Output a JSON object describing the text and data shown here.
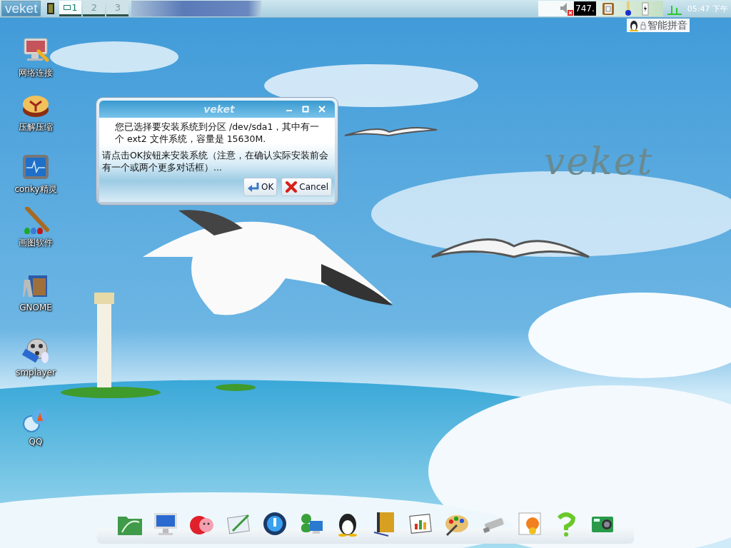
{
  "top_panel": {
    "logo": "veket",
    "workspaces": [
      {
        "label": "1",
        "selected": true
      },
      {
        "label": "2",
        "selected": false
      },
      {
        "label": "3",
        "selected": false
      }
    ],
    "tray": {
      "volume_reading": "747.",
      "clock": "05:47 下午"
    },
    "input_method": "智能拼音"
  },
  "desktop_icons": [
    {
      "label": "网络连接"
    },
    {
      "label": "压解压缩"
    },
    {
      "label": "conky精灵"
    },
    {
      "label": "画图软件"
    },
    {
      "label": "GNOME"
    },
    {
      "label": "smplayer"
    },
    {
      "label": "QQ"
    }
  ],
  "wallpaper_text": "veket",
  "dialog": {
    "title": "veket",
    "message": [
      "您已选择要安装系统到分区 /dev/sda1，其中有一个 ext2 文件系统，容量是 15630M.",
      "请点击OK按钮来安装系统（注意，在确认实际安装前会有一个或两个更多对话框）..."
    ],
    "buttons": [
      {
        "label": "OK",
        "kind": "ok"
      },
      {
        "label": "Cancel",
        "kind": "cancel"
      }
    ]
  }
}
